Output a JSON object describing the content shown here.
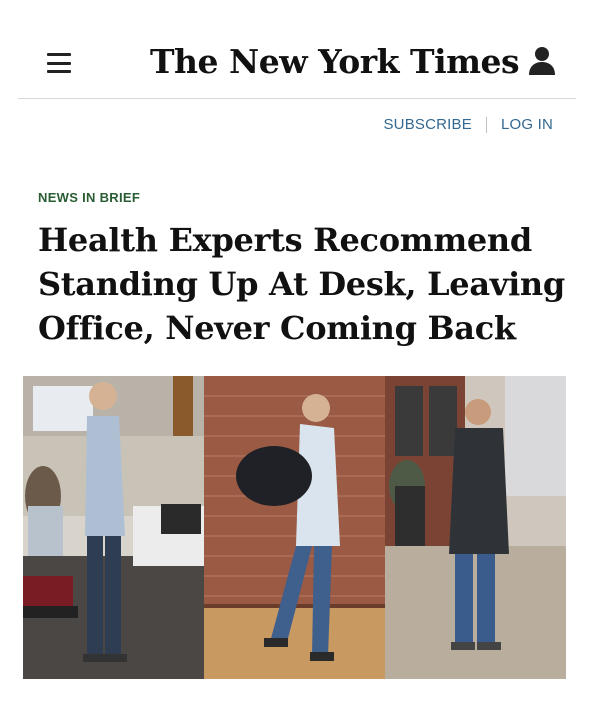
{
  "header": {
    "masthead": "The New York Times",
    "menu_icon": "hamburger-menu-icon",
    "account_icon": "user-account-icon"
  },
  "auth": {
    "subscribe": "SUBSCRIBE",
    "login": "LOG IN"
  },
  "article": {
    "kicker": "NEWS IN BRIEF",
    "headline": "Health Experts Recommend Standing Up At Desk, Leaving Office, Never Coming Back"
  },
  "colors": {
    "link": "#326891",
    "kicker": "#2a5d33",
    "text": "#111111"
  }
}
